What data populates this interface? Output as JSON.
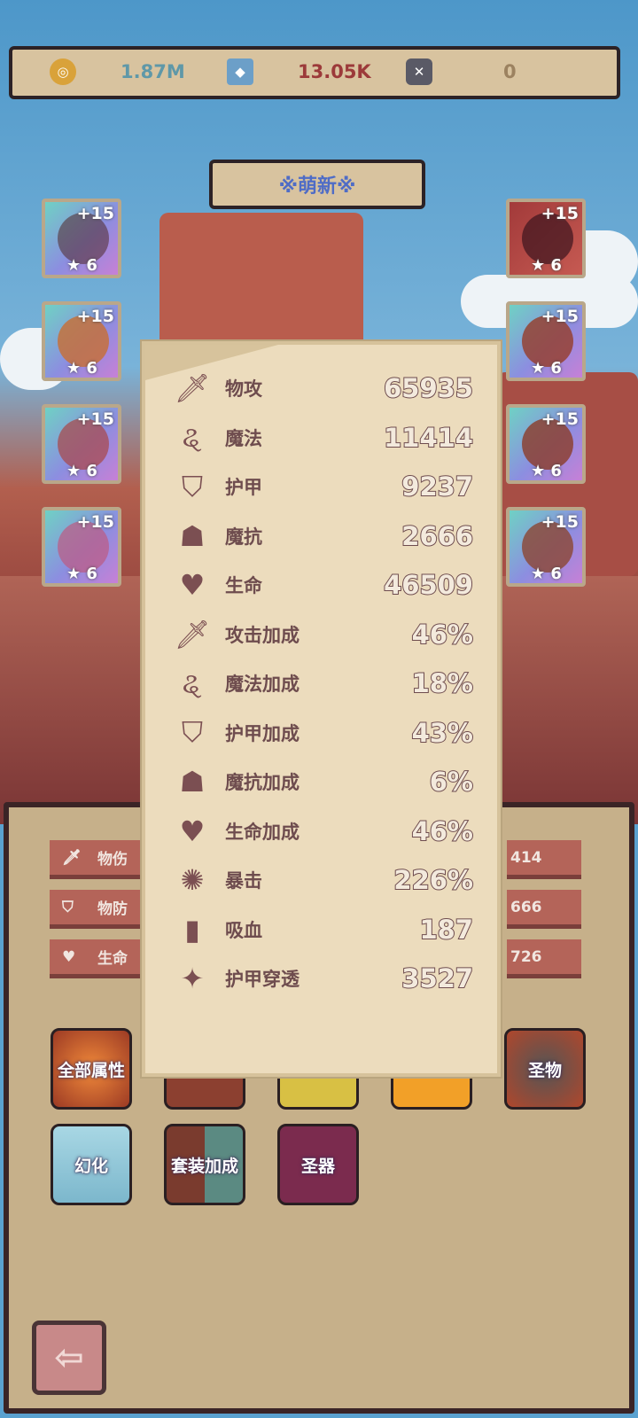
{
  "currencies": [
    {
      "icon": "gold-coin-icon",
      "value": "1.87M",
      "color": "#5f98a8"
    },
    {
      "icon": "blue-crystal-icon",
      "value": "13.05K",
      "color": "#9c3a3a"
    },
    {
      "icon": "dark-rune-icon",
      "value": "0",
      "color": "#9c8260"
    }
  ],
  "title": "※萌新※",
  "equipment_left": [
    {
      "name": "sword-icon",
      "plus": "+15",
      "stars": "★ 6"
    },
    {
      "name": "helmet-icon",
      "plus": "+15",
      "stars": "★ 6"
    },
    {
      "name": "necklace-icon",
      "plus": "+15",
      "stars": "★ 6"
    },
    {
      "name": "amulet-icon",
      "plus": "+15",
      "stars": "★ 6"
    }
  ],
  "equipment_right": [
    {
      "name": "hat-icon",
      "plus": "+15",
      "stars": "★ 6"
    },
    {
      "name": "armor-icon",
      "plus": "+15",
      "stars": "★ 6"
    },
    {
      "name": "gloves-icon",
      "plus": "+15",
      "stars": "★ 6"
    },
    {
      "name": "boots-icon",
      "plus": "+15",
      "stars": "★ 6"
    }
  ],
  "stats_left": [
    {
      "icon": "sword-icon",
      "label": "物伤"
    },
    {
      "icon": "shield-icon",
      "label": "物防"
    },
    {
      "icon": "heart-icon",
      "label": "生命"
    }
  ],
  "stats_right": [
    "414",
    "666",
    "726"
  ],
  "tiles_row1": [
    {
      "label": "全部属性",
      "color": "#b0472c"
    },
    {
      "label": "",
      "color": "#8c4030"
    },
    {
      "label": "",
      "color": "#d8c044"
    },
    {
      "label": "",
      "color": "#f2a028"
    },
    {
      "label": "圣物",
      "color": "#b0472c"
    }
  ],
  "tiles_row2": [
    {
      "label": "幻化",
      "color": "#8fc6d6"
    },
    {
      "label": "套装加成",
      "color": "#5b6e64"
    },
    {
      "label": "圣器",
      "color": "#7b2b4e"
    }
  ],
  "attributes": [
    {
      "icon": "sword-icon",
      "label": "物攻",
      "value": "65935"
    },
    {
      "icon": "magic-swirl-icon",
      "label": "魔法",
      "value": "11414"
    },
    {
      "icon": "shield-icon",
      "label": "护甲",
      "value": "9237"
    },
    {
      "icon": "hood-icon",
      "label": "魔抗",
      "value": "2666"
    },
    {
      "icon": "heart-icon",
      "label": "生命",
      "value": "46509"
    },
    {
      "icon": "sword-icon",
      "label": "攻击加成",
      "value": "46%"
    },
    {
      "icon": "magic-swirl-icon",
      "label": "魔法加成",
      "value": "18%"
    },
    {
      "icon": "shield-icon",
      "label": "护甲加成",
      "value": "43%"
    },
    {
      "icon": "hood-icon",
      "label": "魔抗加成",
      "value": "6%"
    },
    {
      "icon": "heart-icon",
      "label": "生命加成",
      "value": "46%"
    },
    {
      "icon": "crit-burst-icon",
      "label": "暴击",
      "value": "226%"
    },
    {
      "icon": "lifesteal-book-icon",
      "label": "吸血",
      "value": "187"
    },
    {
      "icon": "shuriken-icon",
      "label": "护甲穿透",
      "value": "3527"
    }
  ],
  "back_button": {
    "icon": "back-arrow-icon"
  }
}
